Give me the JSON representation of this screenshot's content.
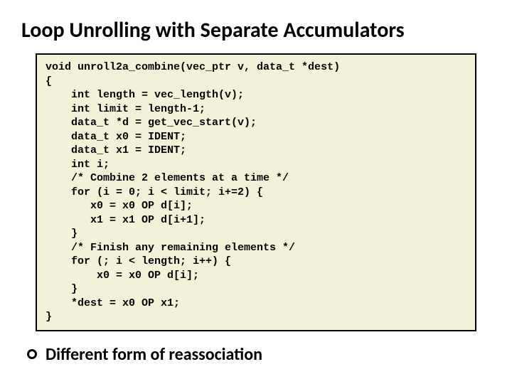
{
  "title": "Loop Unrolling with Separate Accumulators",
  "code": "void unroll2a_combine(vec_ptr v, data_t *dest)\n{\n    int length = vec_length(v);\n    int limit = length-1;\n    data_t *d = get_vec_start(v);\n    data_t x0 = IDENT;\n    data_t x1 = IDENT;\n    int i;\n    /* Combine 2 elements at a time */\n    for (i = 0; i < limit; i+=2) {\n       x0 = x0 OP d[i];\n       x1 = x1 OP d[i+1];\n    }\n    /* Finish any remaining elements */\n    for (; i < length; i++) {\n        x0 = x0 OP d[i];\n    }\n    *dest = x0 OP x1;\n}",
  "bullet": "Different form of reassociation"
}
